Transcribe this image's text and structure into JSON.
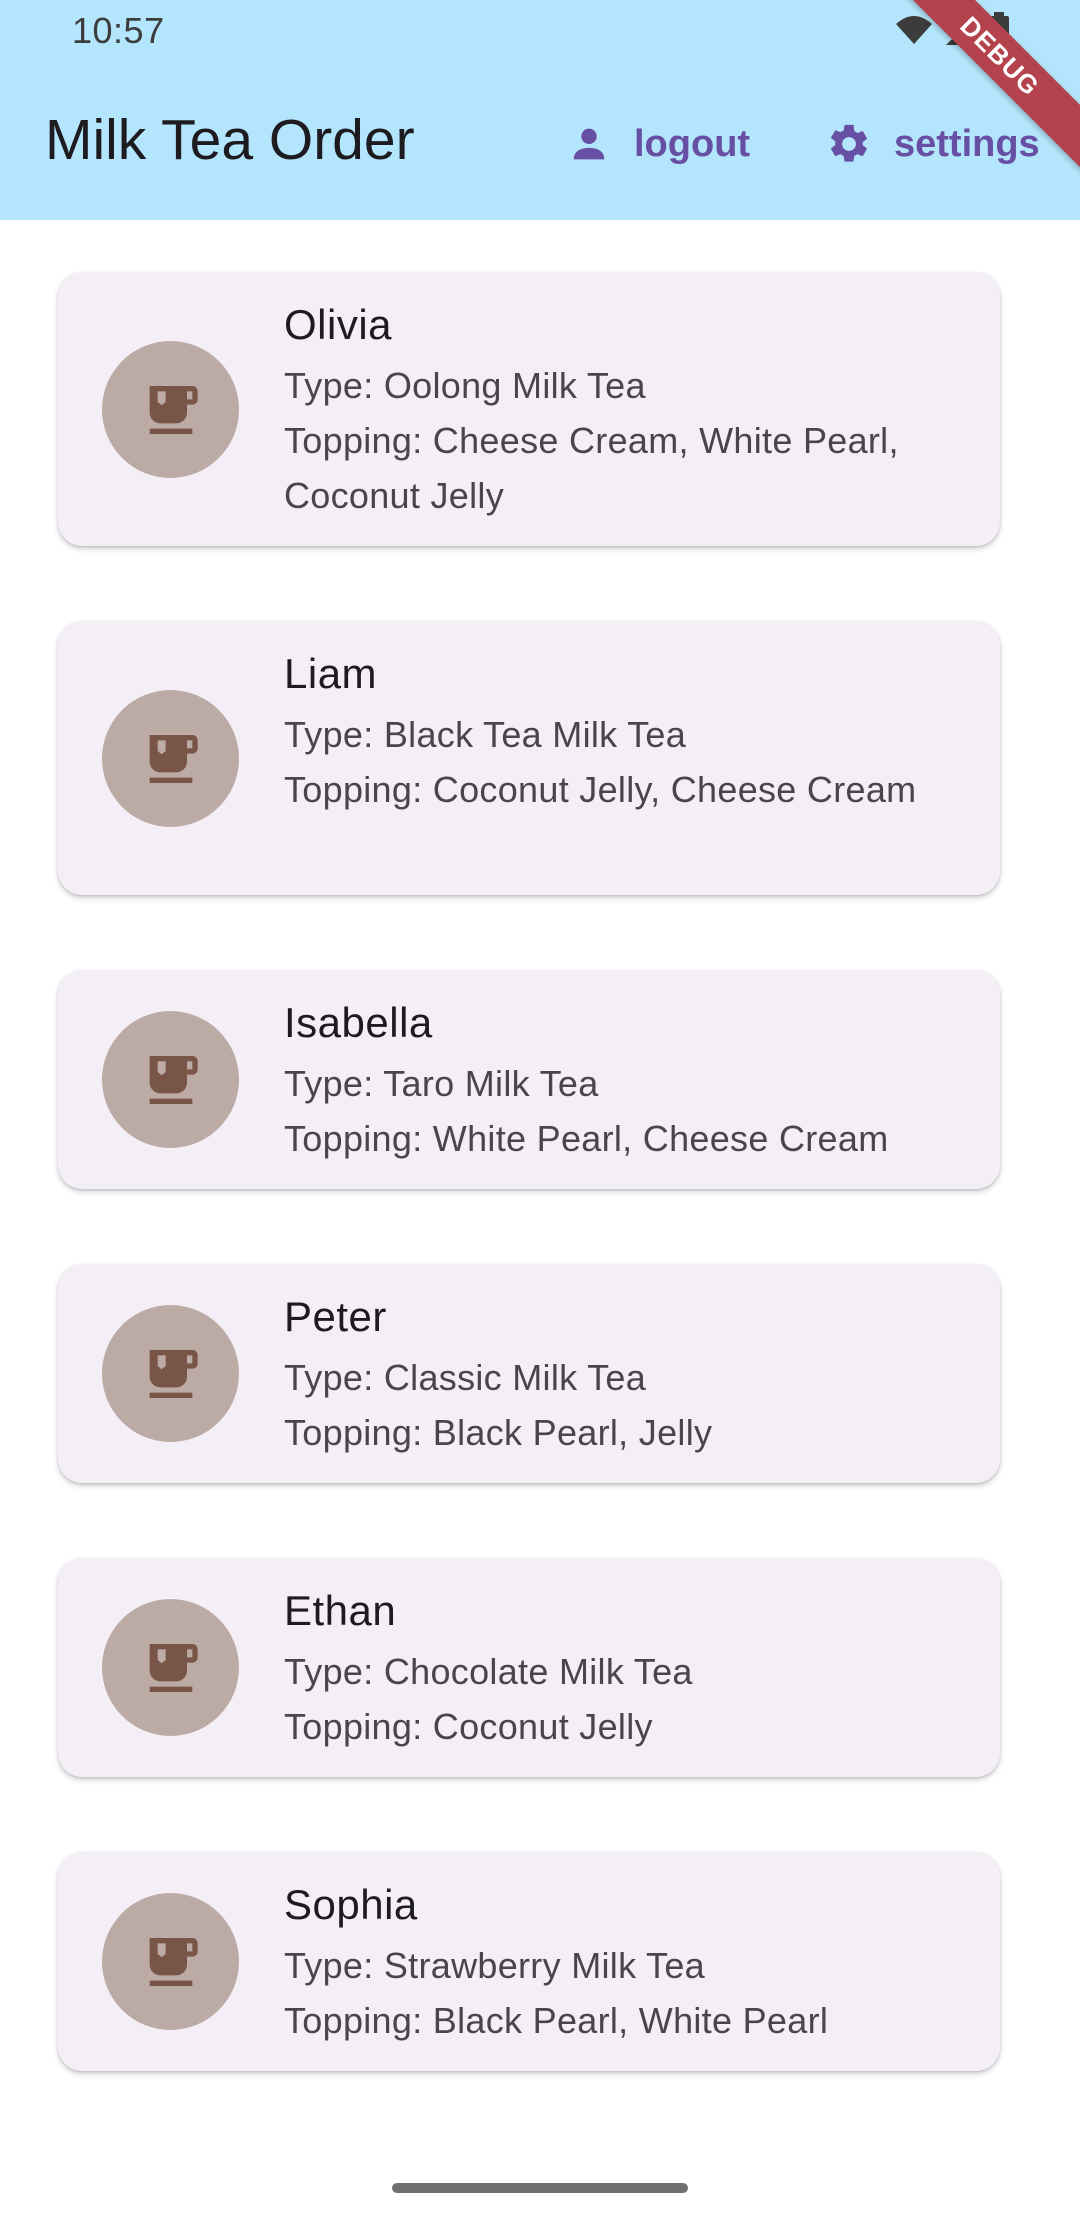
{
  "status_bar": {
    "time": "10:57",
    "icons": [
      "wifi-icon",
      "cellular-signal-icon",
      "battery-icon"
    ]
  },
  "debug_banner": "DEBUG",
  "app_bar": {
    "title": "Milk Tea Order",
    "actions": [
      {
        "label": "logout",
        "icon": "person-icon"
      },
      {
        "label": "settings",
        "icon": "gear-icon"
      }
    ]
  },
  "orders": [
    {
      "name": "Olivia",
      "type": "Type: Oolong Milk Tea",
      "topping": "Topping: Cheese Cream, White Pearl, Coconut Jelly",
      "icon": "coffee-cup-icon"
    },
    {
      "name": "Liam",
      "type": "Type: Black Tea Milk Tea",
      "topping": "Topping: Coconut Jelly, Cheese Cream",
      "icon": "coffee-cup-icon"
    },
    {
      "name": "Isabella",
      "type": "Type: Taro Milk Tea",
      "topping": "Topping: White Pearl, Cheese Cream",
      "icon": "coffee-cup-icon"
    },
    {
      "name": "Peter",
      "type": "Type: Classic Milk Tea",
      "topping": "Topping: Black Pearl, Jelly",
      "icon": "coffee-cup-icon"
    },
    {
      "name": "Ethan",
      "type": "Type: Chocolate Milk Tea",
      "topping": "Topping: Coconut Jelly",
      "icon": "coffee-cup-icon"
    },
    {
      "name": "Sophia",
      "type": "Type: Strawberry Milk Tea",
      "topping": "Topping: Black Pearl, White Pearl",
      "icon": "coffee-cup-icon"
    }
  ],
  "colors": {
    "app_bar_background": "#b3e5fc",
    "accent": "#6750a4",
    "card_background": "#f4eff6",
    "avatar_background": "#bcaaa4",
    "avatar_icon": "#795548",
    "debug_banner": "#b4434d"
  }
}
